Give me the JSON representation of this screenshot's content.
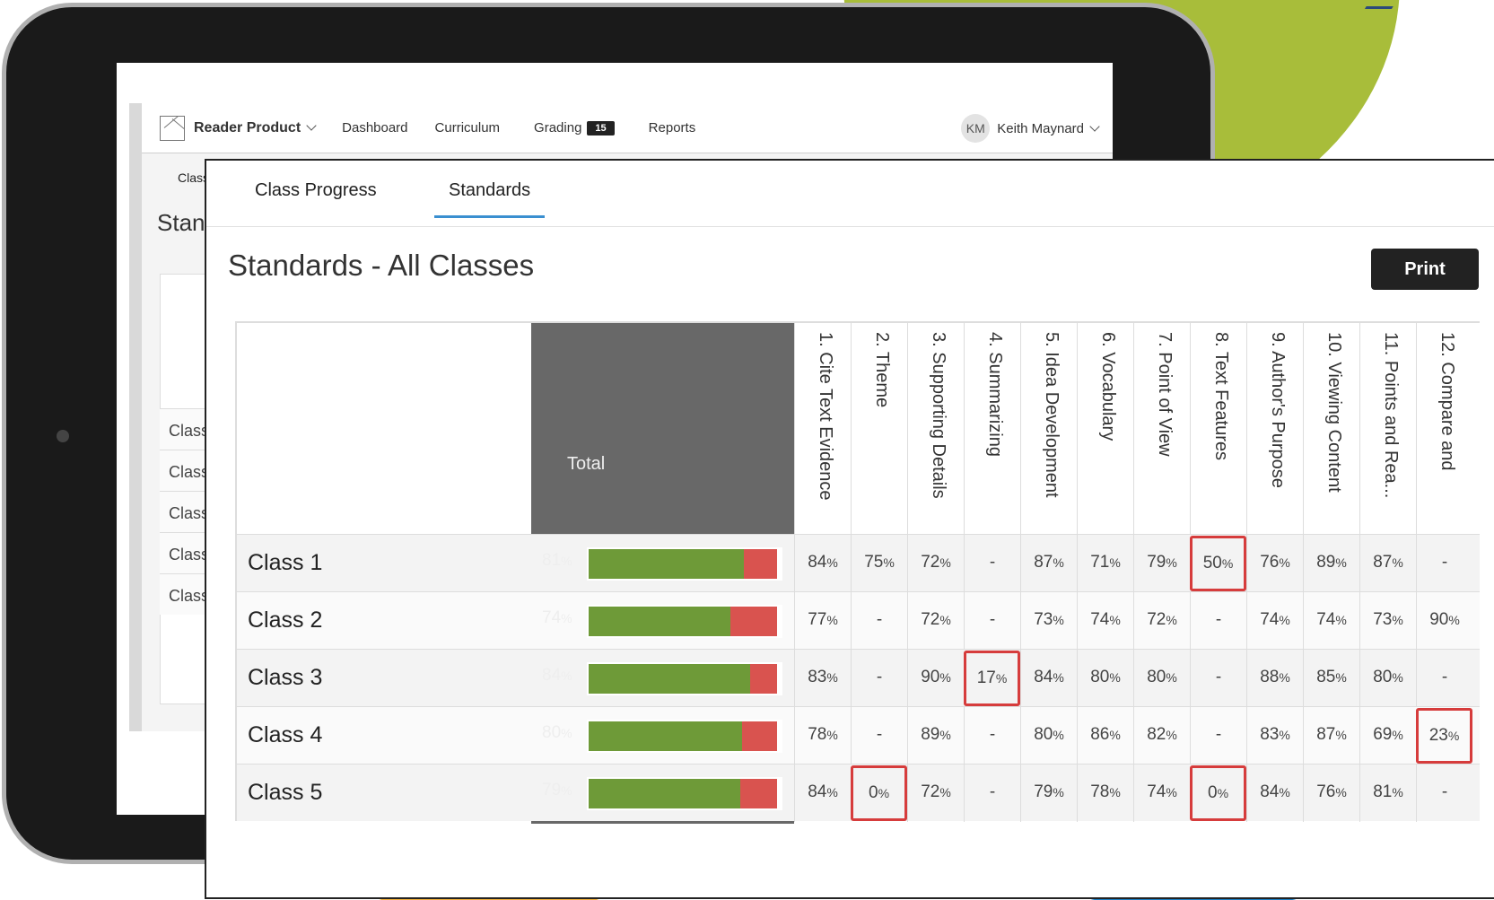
{
  "nav": {
    "brand": "Reader Product",
    "links": {
      "dashboard": "Dashboard",
      "curriculum": "Curriculum",
      "grading": "Grading",
      "reports": "Reports"
    },
    "grading_badge": "15",
    "user_initials": "KM",
    "user_name": "Keith Maynard"
  },
  "background_page": {
    "crumb": "Class",
    "title": "Stand",
    "rows": [
      "Class",
      "Class",
      "Class",
      "Class",
      "Class"
    ]
  },
  "tabs": [
    "Class Progress",
    "Standards"
  ],
  "active_tab": "Standards",
  "page_title": "Standards - All Classes",
  "print_label": "Print",
  "total_label": "Total",
  "standards": [
    "1. Cite Text Evidence",
    "2. Theme",
    "3. Supporting Details",
    "4. Summarizing",
    "5. Idea Development",
    "6. Vocabulary",
    "7. Point of View",
    "8. Text Features",
    "9. Author's Purpose",
    "10. Viewing Content",
    "11. Points and Rea...",
    "12. Compare and"
  ],
  "classes": [
    {
      "name": "Class 1",
      "total": "81",
      "values": [
        "84",
        "75",
        "72",
        "-",
        "87",
        "71",
        "79",
        "50",
        "76",
        "89",
        "87",
        "-"
      ],
      "flags": [
        7
      ]
    },
    {
      "name": "Class 2",
      "total": "74",
      "values": [
        "77",
        "-",
        "72",
        "-",
        "73",
        "74",
        "72",
        "-",
        "74",
        "74",
        "73",
        "90"
      ],
      "flags": []
    },
    {
      "name": "Class 3",
      "total": "84",
      "values": [
        "83",
        "-",
        "90",
        "17",
        "84",
        "80",
        "80",
        "-",
        "88",
        "85",
        "80",
        "-"
      ],
      "flags": [
        3
      ]
    },
    {
      "name": "Class 4",
      "total": "80",
      "values": [
        "78",
        "-",
        "89",
        "-",
        "80",
        "86",
        "82",
        "-",
        "83",
        "87",
        "69",
        "23"
      ],
      "flags": [
        11
      ]
    },
    {
      "name": "Class 5",
      "total": "79",
      "values": [
        "84",
        "0",
        "72",
        "-",
        "79",
        "78",
        "74",
        "0",
        "84",
        "76",
        "81",
        "-"
      ],
      "flags": [
        1,
        7
      ]
    }
  ],
  "colors": {
    "bar_green": "#6e9a38",
    "bar_red": "#d9534f",
    "flag_border": "#d63c3c",
    "tab_active": "#3a8fd0"
  }
}
